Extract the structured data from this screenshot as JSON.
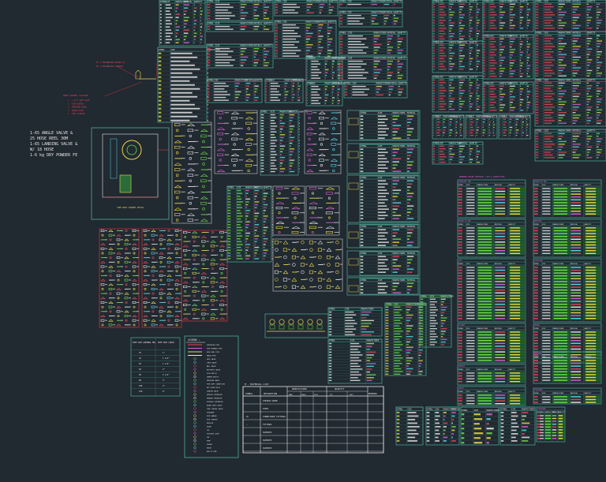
{
  "colors": {
    "background": "#212931",
    "table_frame": "#4fae9b",
    "table_grid": "#2f6f66",
    "text_white": "#e6e6e6",
    "text_red": "#e24a5a",
    "text_green": "#6fdc4c",
    "text_yellow": "#e8d84a",
    "text_magenta": "#d660d0",
    "text_cyan": "#59d7e6",
    "highlight_fill": "#1f5e2a",
    "leader_red": "#c8323c",
    "panel_frame": "#9fa3a8"
  },
  "notes": {
    "riser_label_1": "FF 1 SPRINKLER RISER AT",
    "riser_label_2": "FF 1 SPRINKLER CONTROL",
    "zone_title": "ZONE CONTROL STATION",
    "zone_lines": [
      "1 - 1 1/2\" GATE VALVE",
      "2 - FLOW SWITCH",
      "3 - PRESSURE GAUGE",
      "4 - DRAIN VALVE",
      "5 - TEST & DRAIN"
    ],
    "hose_reel_lines": [
      "1-65 ANGLE VALVE &",
      "25 HOSE REEL 30M",
      "1-65 LANDING VALVE &",
      "W/ 18 HOSE",
      "1-6 kg DRY POWDER FE"
    ],
    "fhc_plan_title": "FIRE HOSE CABINET DETAIL"
  },
  "legend": {
    "title": "LEGEND :",
    "items": [
      "SPRINKLER PIPE",
      "FIRE HYDRANT PIPE",
      "HOSE REEL PIPE",
      "DRAIN PIPE",
      "GATE VALVE",
      "CHECK VALVE",
      "BALL VALVE",
      "BUTTERFLY VALVE",
      "FLOW SWITCH",
      "TAMPER SWITCH",
      "PRESSURE GAUGE",
      "FIRE DEPT CONNECTION",
      "WET RISER INLET",
      "LANDING VALVE",
      "UPRIGHT SPRINKLER",
      "PENDENT SPRINKLER",
      "SIDEWALL SPRINKLER",
      "ALARM CHECK VALVE",
      "ZONE CONTROL VALVE",
      "STRAINER",
      "PIPE HANGER",
      "PIPE SUPPORT",
      "REDUCER",
      "ELBOW",
      "TEE",
      "FLEXIBLE JOINT",
      "CAP",
      "PUMP",
      "FLANGE",
      "UNION",
      "END OF LINE"
    ]
  },
  "material_list": {
    "title": "M - MATERIAL LIST",
    "headers": [
      "SYMBOL",
      "DESCRIPTION",
      "MANUFACTURER",
      "QUANTITY",
      "REMARKS"
    ],
    "manufacturer_sub": [
      "MAKE",
      "MODEL",
      "SIZE"
    ],
    "quantity_sub": [
      "QTY",
      "UNIT"
    ],
    "rows": [
      "VARIOUS GRADE",
      "PIPES",
      "CONNECTABLE FITTINGS",
      "FITTINGS",
      "SUPPORTS",
      "SUPPORTS",
      "SUPPORTS"
    ],
    "row_symbols": [
      "",
      "",
      "CP",
      "—",
      "",
      "",
      ""
    ]
  },
  "pipe_size_table": {
    "headers": [
      "PIPE SIZE (NOMINAL MM)",
      "PIPE SIZE (INCH)"
    ],
    "rows": [
      [
        "25",
        "1\""
      ],
      [
        "32",
        "1 1/4\""
      ],
      [
        "40",
        "1 1/2\""
      ],
      [
        "50",
        "2\""
      ],
      [
        "65",
        "2 1/2\""
      ],
      [
        "80",
        "3\""
      ],
      [
        "100",
        "4\""
      ],
      [
        "150",
        "6\""
      ]
    ]
  },
  "mat_header": {
    "title": "NUMBERS BASED MATERIAL LIST & QUANTITIES",
    "cols": [
      "SYMBOL",
      "SIZE",
      "MANUFACTURER",
      "MATERIAL",
      "QUANTITY"
    ]
  },
  "section_titles": [
    "STRAIGHT TEE",
    "ELBOW 90 DEG",
    "ELBOW 45 DEG",
    "REDUCER",
    "CAP",
    "COUPLING",
    "FLANGE",
    "UNION",
    "NIPPLE",
    "BUSHING",
    "CROSS",
    "STRAINER"
  ],
  "table_cols": [
    "SYMBOL",
    "SIZE",
    "MANUFACTURER",
    "MATERIAL",
    "QUANTITY"
  ],
  "sample_values": {
    "red_sizes": [
      "25",
      "32",
      "40",
      "50",
      "65",
      "80",
      "100",
      "150"
    ],
    "yellow_qty": [
      "12",
      "8",
      "24",
      "6",
      "18",
      "4",
      "10",
      "2"
    ],
    "green_desc": [
      "GALV. STEEL",
      "BLACK STEEL",
      "SCH 40",
      "CLASS 150"
    ]
  }
}
